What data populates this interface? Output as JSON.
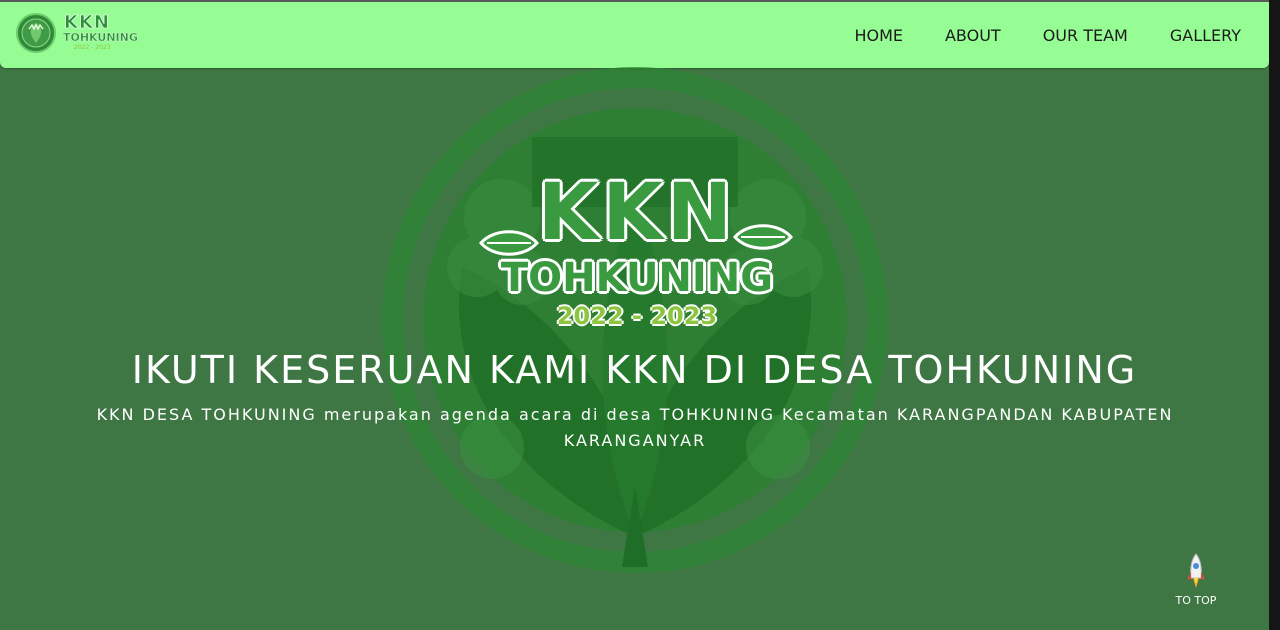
{
  "brand": {
    "word": "KKN",
    "sub": "TOHKUNING",
    "years": "2022 - 2023"
  },
  "nav": {
    "items": [
      {
        "label": "HOME"
      },
      {
        "label": "ABOUT"
      },
      {
        "label": "OUR TEAM"
      },
      {
        "label": "GALLERY"
      }
    ]
  },
  "hero": {
    "logo_word": "KKN",
    "logo_name": "TOHKUNING",
    "logo_years": "2022 - 2023",
    "title": "IKUTI KESERUAN KAMI KKN DI DESA TOHKUNING",
    "description": "KKN DESA TOHKUNING merupakan agenda acara di desa TOHKUNING Kecamatan KARANGPANDAN KABUPATEN KARANGANYAR"
  },
  "to_top": {
    "label": "TO TOP",
    "icon": "rocket-icon"
  },
  "colors": {
    "navbar": "#96fd94",
    "background": "#3f7744",
    "brand_green": "#3a9a3f",
    "year_green": "#8cc63f"
  }
}
